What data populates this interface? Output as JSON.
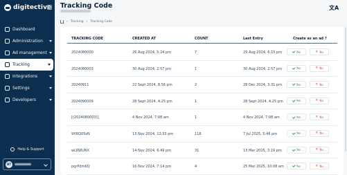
{
  "sidebar": {
    "brand": "digitective",
    "items": [
      {
        "label": "Dashboard",
        "icon": "home-icon",
        "has_caret": false
      },
      {
        "label": "Administration",
        "icon": "settings-icon",
        "has_caret": true
      },
      {
        "label": "Ad management",
        "icon": "ad-icon",
        "has_caret": true
      },
      {
        "label": "Tracking",
        "icon": "tracking-icon",
        "has_caret": true,
        "active": true
      },
      {
        "label": "Integrations",
        "icon": "integrations-icon",
        "has_caret": true
      },
      {
        "label": "Settings",
        "icon": "gear-icon",
        "has_caret": true
      },
      {
        "label": "Developers",
        "icon": "code-icon",
        "has_caret": true
      }
    ],
    "help_label": "Help & Support",
    "user_initials": "BT"
  },
  "header": {
    "title": "Tracking Code"
  },
  "breadcrumb": [
    "Tracking",
    "Tracking Code"
  ],
  "table": {
    "columns": [
      "TRACKING CODE",
      "CREATED AT",
      "COUNT",
      "Last Entry",
      "Create as an ad ?"
    ],
    "yes_label": "Yes",
    "no_label": "No",
    "rows": [
      {
        "code": "2024080000",
        "created": "26 Aug 2024, 5:24 pm",
        "count": "7",
        "last": "29 Aug 2024, 6:15 pm"
      },
      {
        "code": "2024080003",
        "created": "30 Aug 2024, 2:57 pm",
        "count": "1",
        "last": "30 Aug 2024, 2:57 pm"
      },
      {
        "code": "20240911",
        "created": "22 Sept 2024, 8:56 pm",
        "count": "2",
        "last": "28 Dec 2024, 3:31 pm"
      },
      {
        "code": "2024090009",
        "created": "28 Sept 2024, 4:25 pm",
        "count": "1",
        "last": "28 Sept 2024, 4:25 pm"
      },
      {
        "code": "[(2024080003)]",
        "created": "4 Nov 2024, 7:08 am",
        "count": "1",
        "last": "4 Nov 2024, 7:08 am"
      },
      {
        "code": "9XRQ05zN",
        "created": "13 Nov 2024, 12:33 pm",
        "count": "118",
        "last": "7 Jul 2025, 5:46 pm"
      },
      {
        "code": "wLRWUNX",
        "created": "14 Nov 2024, 6:49 pm",
        "count": "31",
        "last": "13 Mar 2025, 3:19 pm"
      },
      {
        "code": "pqrPdmKQ",
        "created": "16 Nov 2024, 7:14 pm",
        "count": "4",
        "last": "25 Mar 2025, 10:08 am"
      }
    ]
  },
  "colors": {
    "sidebar_bg": "#0d2f4f",
    "page_bg": "#f4f6f8",
    "yes_color": "#3e9b5a",
    "no_color": "#d64545"
  }
}
